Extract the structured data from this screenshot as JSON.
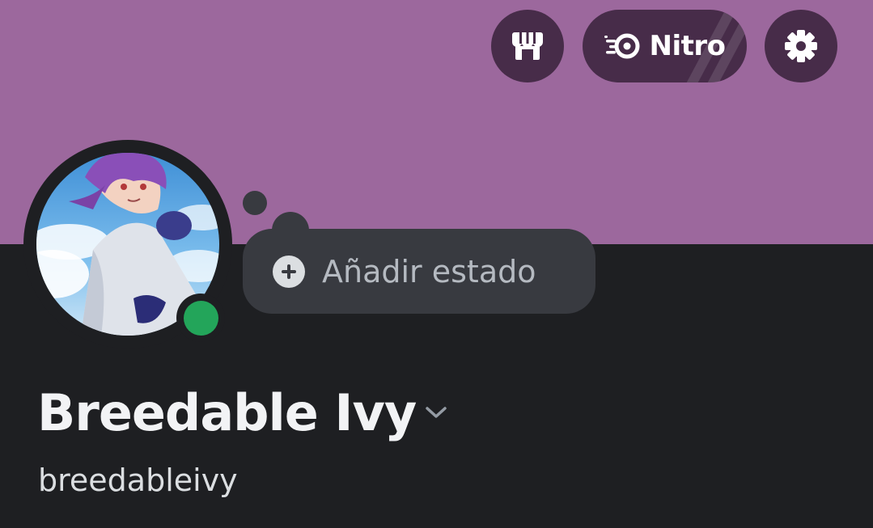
{
  "header": {
    "nitro_label": "Nitro"
  },
  "status": {
    "add_label": "Añadir estado",
    "online": true
  },
  "profile": {
    "display_name": "Breedable Ivy",
    "username": "breedableivy"
  },
  "icons": {
    "shop": "shop-icon",
    "nitro": "nitro-icon",
    "settings": "gear-icon",
    "add_status": "plus-circle-icon",
    "name_dropdown": "chevron-down-icon"
  },
  "colors": {
    "banner": "#9c689d",
    "background": "#1e1f22",
    "button": "#472c49",
    "bubble": "#383a40",
    "online": "#23a55a"
  }
}
